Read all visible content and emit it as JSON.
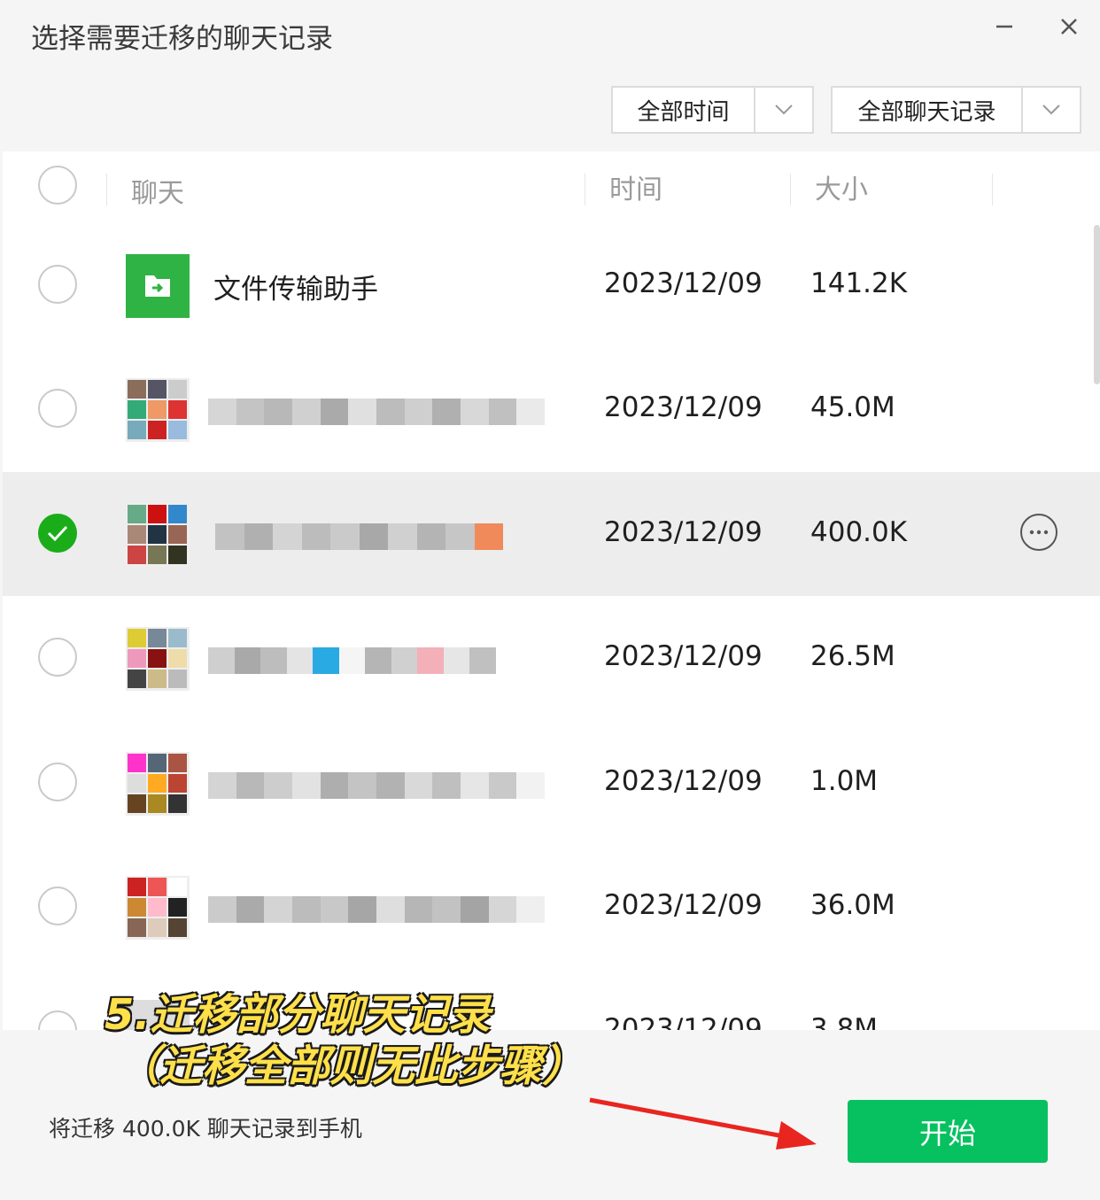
{
  "window": {
    "title": "选择需要迁移的聊天记录",
    "minimize_icon": "minimize-icon",
    "close_icon": "close-icon"
  },
  "filters": {
    "time_filter": "全部时间",
    "type_filter": "全部聊天记录"
  },
  "list": {
    "columns": [
      "聊天",
      "时间",
      "大小"
    ],
    "rows": [
      {
        "name": "文件传输助手",
        "time": "2023/12/09",
        "size": "141.2K",
        "checked": false,
        "avatar": "file-transfer-icon",
        "blurred": false
      },
      {
        "name": "",
        "time": "2023/12/09",
        "size": "45.0M",
        "checked": false,
        "avatar": "group-avatar",
        "blurred": true
      },
      {
        "name": "",
        "time": "2023/12/09",
        "size": "400.0K",
        "checked": true,
        "avatar": "group-avatar",
        "blurred": true
      },
      {
        "name": "",
        "time": "2023/12/09",
        "size": "26.5M",
        "checked": false,
        "avatar": "group-avatar",
        "blurred": true
      },
      {
        "name": "",
        "time": "2023/12/09",
        "size": "1.0M",
        "checked": false,
        "avatar": "group-avatar",
        "blurred": true
      },
      {
        "name": "",
        "time": "2023/12/09",
        "size": "36.0M",
        "checked": false,
        "avatar": "group-avatar",
        "blurred": true
      },
      {
        "name": "",
        "time": "2023/12/09",
        "size": "3.8M",
        "checked": false,
        "avatar": "group-avatar",
        "blurred": true
      }
    ]
  },
  "footer": {
    "summary": "将迁移 400.0K 聊天记录到手机",
    "start_label": "开始"
  },
  "annotation": {
    "line1": "5.迁移部分聊天记录",
    "line2": "（迁移全部则无此步骤）"
  },
  "colors": {
    "accent_green": "#07c160",
    "check_green": "#1aad19",
    "annotation_yellow": "#ffe04a",
    "arrow_red": "#e8251f"
  }
}
